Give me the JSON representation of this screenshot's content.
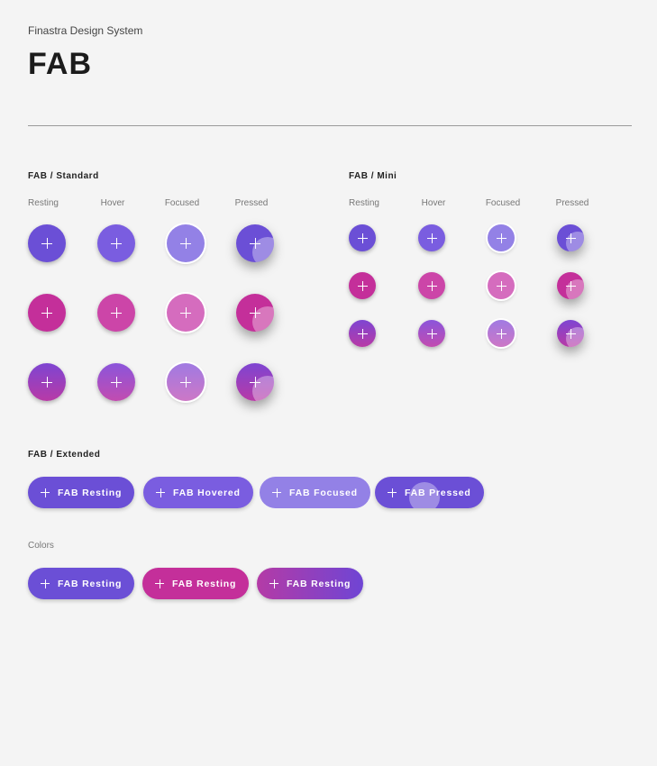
{
  "header": {
    "subtitle": "Finastra Design System",
    "title": "FAB"
  },
  "standard": {
    "label": "FAB / Standard",
    "states": [
      "Resting",
      "Hover",
      "Focused",
      "Pressed"
    ]
  },
  "mini": {
    "label": "FAB / Mini",
    "states": [
      "Resting",
      "Hover",
      "Focused",
      "Pressed"
    ]
  },
  "extended": {
    "label": "FAB / Extended",
    "buttons": [
      "FAB Resting",
      "FAB Hovered",
      "FAB Focused",
      "FAB Pressed"
    ]
  },
  "colors": {
    "label": "Colors",
    "buttons": [
      "FAB Resting",
      "FAB Resting",
      "FAB Resting"
    ]
  },
  "palette": {
    "purple": "#6b4fd6",
    "purple_hover": "#7a5de0",
    "purple_focus": "#9381e6",
    "magenta": "#c42f9a",
    "magenta_hover": "#cc45a8",
    "magenta_focus": "#d56cbe",
    "gradient_start": "#c33a9c",
    "gradient_end": "#6f45d4",
    "background": "#f4f4f4"
  }
}
